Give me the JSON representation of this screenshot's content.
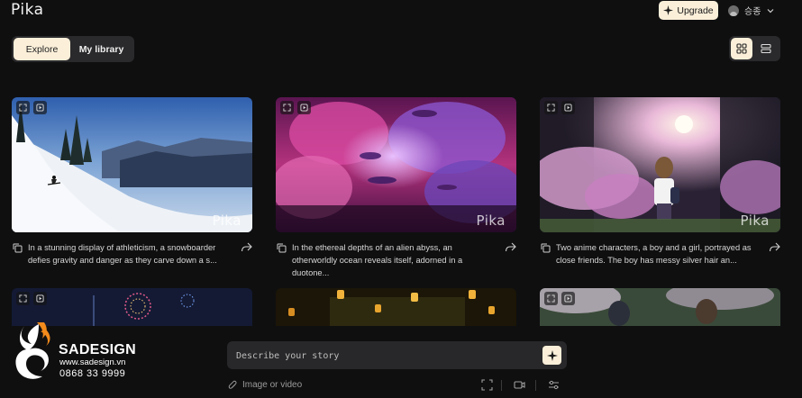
{
  "header": {
    "logo": "Pika",
    "upgrade_label": "Upgrade",
    "user_name": "승종"
  },
  "tabs": [
    {
      "label": "Explore",
      "active": true
    },
    {
      "label": "My library",
      "active": false
    }
  ],
  "view_toggle": [
    "grid-view-icon",
    "list-view-icon"
  ],
  "watermark": "Pika",
  "cards": [
    {
      "description": "In a stunning display of athleticism, a snowboarder defies gravity and danger as they carve down a s...",
      "scene": "snowy-mountain"
    },
    {
      "description": "In the ethereal depths of an alien abyss, an otherworldly ocean reveals itself, adorned in a duotone...",
      "scene": "alien-abyss"
    },
    {
      "description": "Two anime characters, a boy and a girl, portrayed as close friends. The boy has messy silver hair an...",
      "scene": "anime-blossoms"
    },
    {
      "description": "",
      "scene": "fireworks"
    },
    {
      "description": "",
      "scene": "lanterns"
    },
    {
      "description": "",
      "scene": "anime-forest"
    }
  ],
  "prompt": {
    "placeholder": "Describe your story",
    "attach_label": "Image or video"
  },
  "brand": {
    "name": "SADESIGN",
    "website": "www.sadesign.vn",
    "phone": "0868 33 9999"
  },
  "colors": {
    "background": "#0f0f10",
    "accent": "#fbefd9",
    "panel": "#2a2a2c"
  }
}
